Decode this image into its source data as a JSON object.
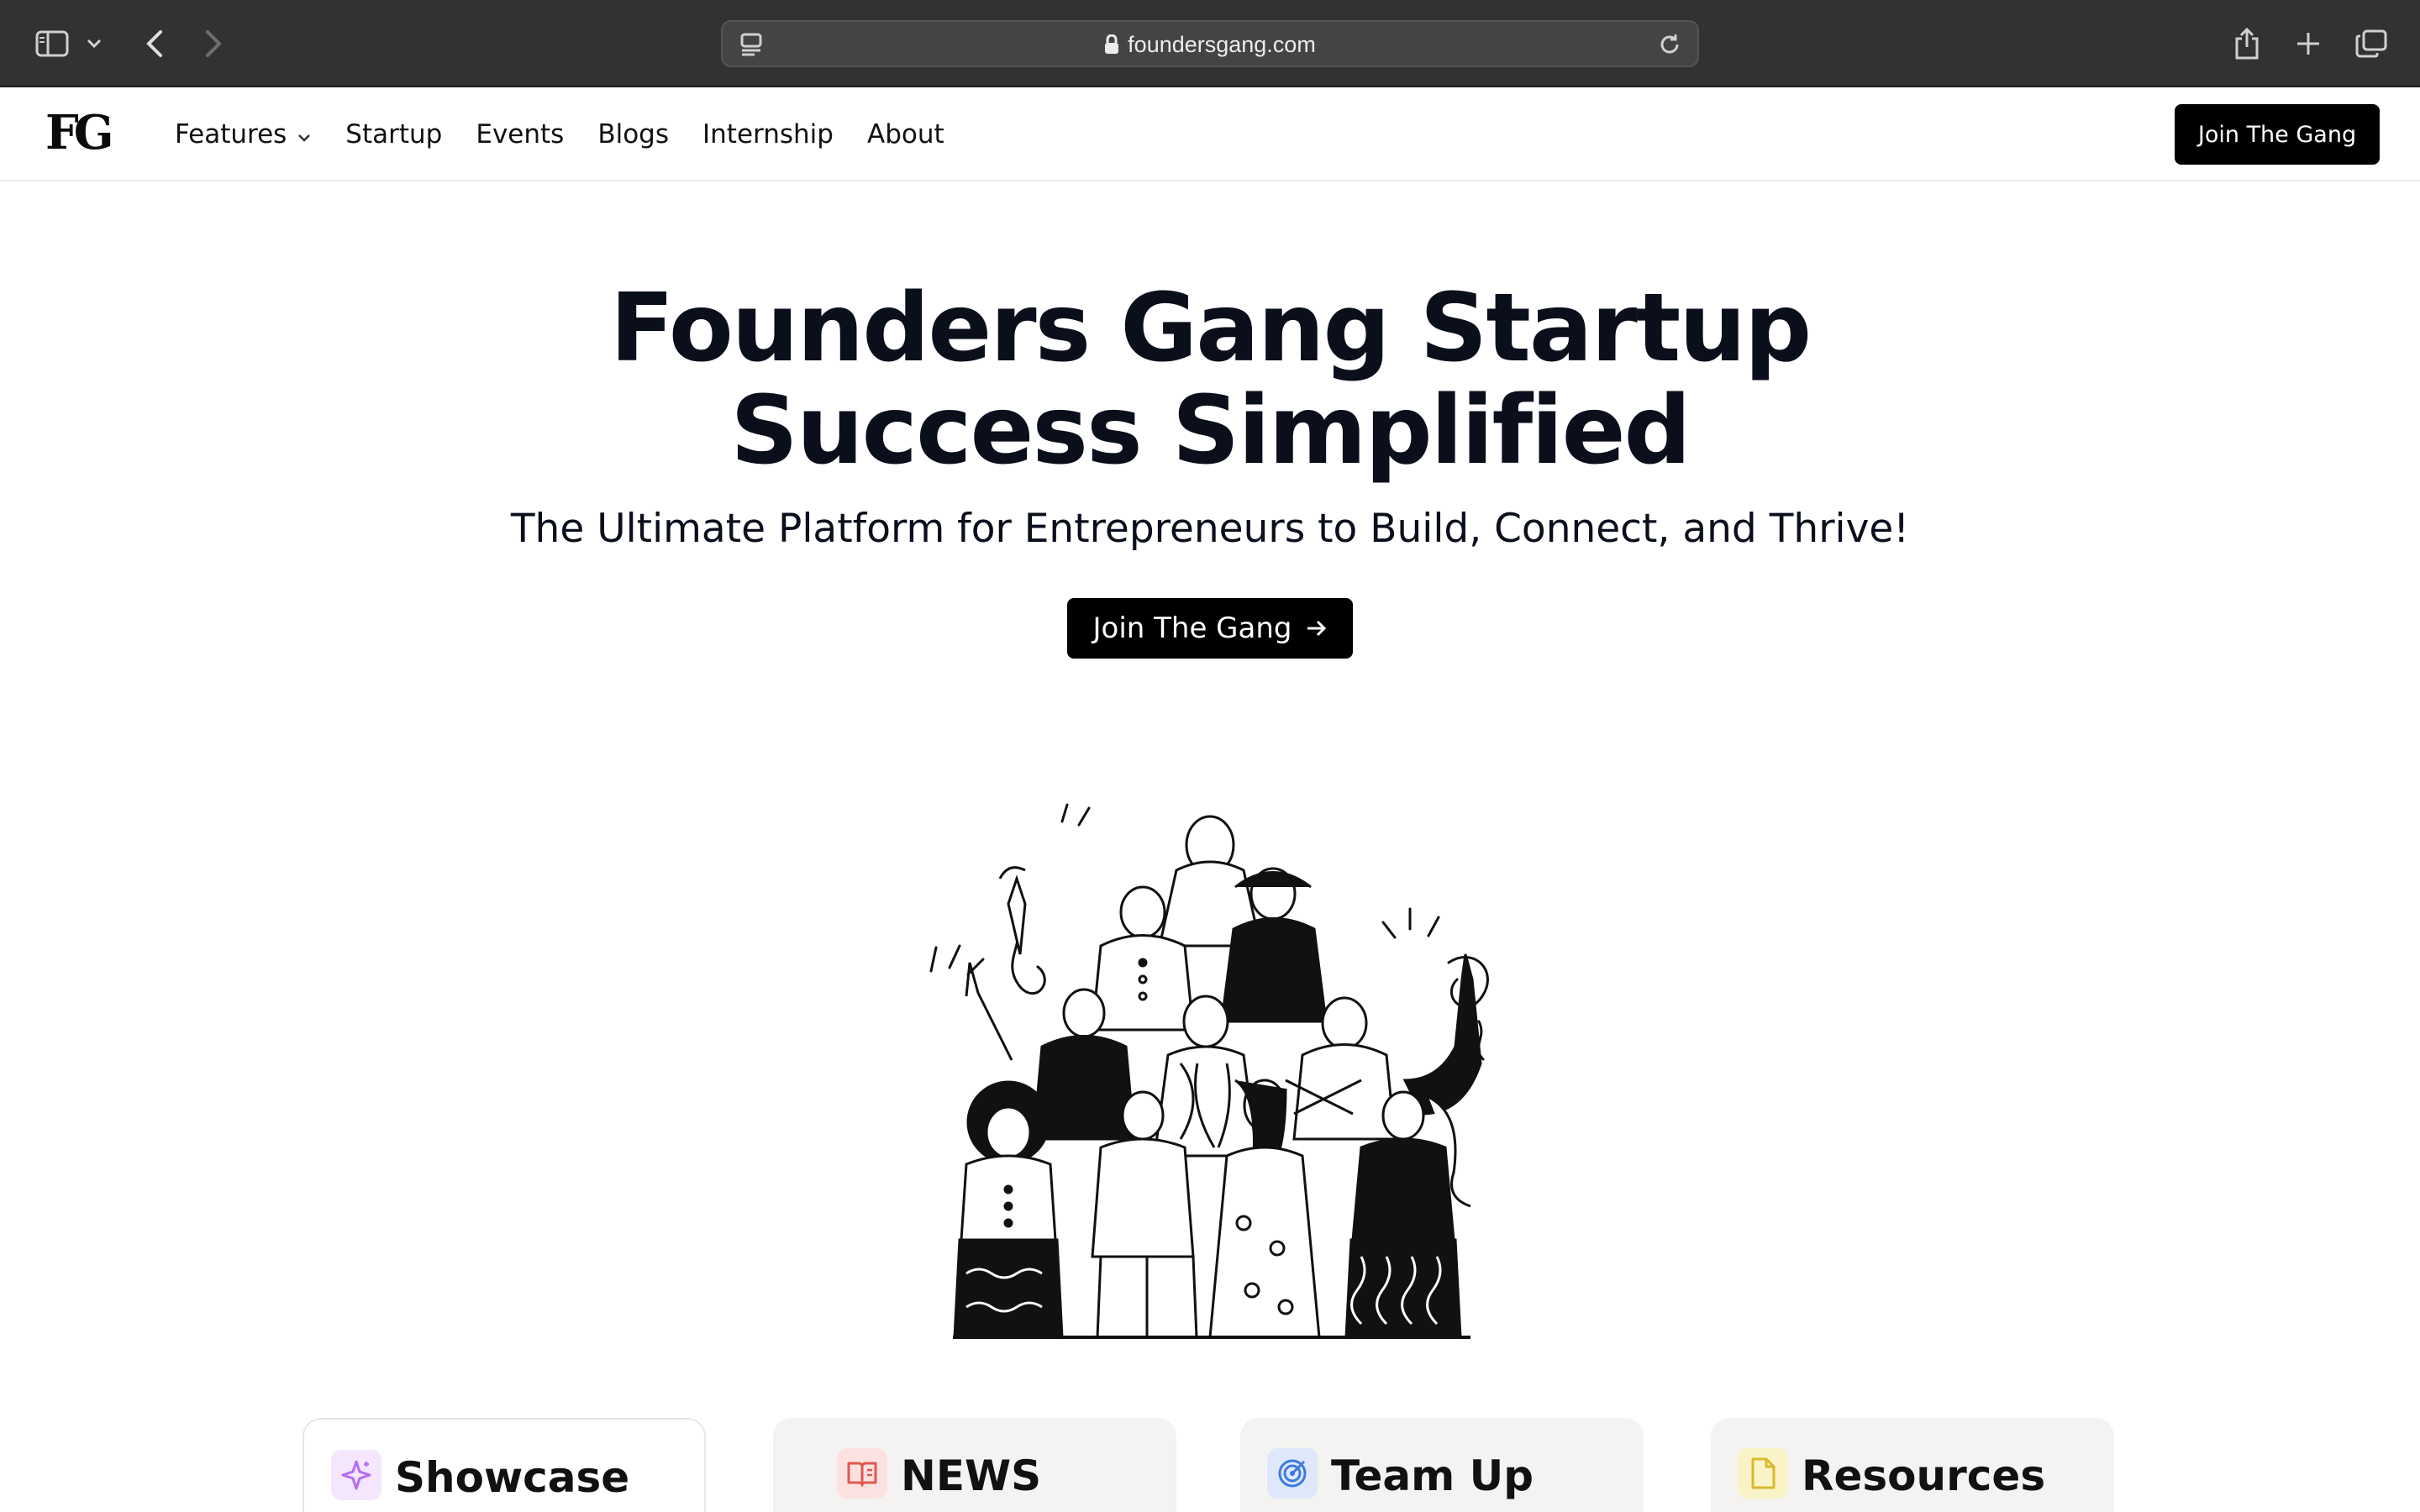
{
  "browser": {
    "url": "foundersgang.com"
  },
  "nav": {
    "logo": "FG",
    "links": [
      "Features",
      "Startup",
      "Events",
      "Blogs",
      "Internship",
      "About"
    ],
    "cta": "Join The Gang"
  },
  "hero": {
    "title_line1": "Founders Gang Startup",
    "title_line2": "Success Simplified",
    "subtitle": "The Ultimate Platform for Entrepreneurs to Build, Connect, and Thrive!",
    "cta": "Join The Gang"
  },
  "cards": [
    {
      "label": "Showcase",
      "icon": "sparkle-icon",
      "color": "#b66cf0"
    },
    {
      "label": "NEWS",
      "icon": "open-book-icon",
      "color": "#e0574f"
    },
    {
      "label": "Team Up",
      "icon": "target-icon",
      "color": "#3f7be0"
    },
    {
      "label": "Resources",
      "icon": "file-icon",
      "color": "#d9b92a"
    }
  ]
}
